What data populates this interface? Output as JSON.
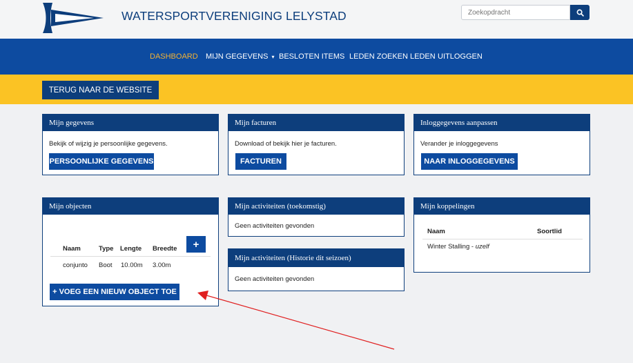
{
  "header": {
    "site_title": "WATERSPORTVERENIGING LELYSTAD",
    "search_placeholder": "Zoekopdracht"
  },
  "nav": {
    "items": [
      {
        "label": "DASHBOARD",
        "active": true
      },
      {
        "label": "MIJN GEGEVENS",
        "dropdown": true
      },
      {
        "label": "BESLOTEN ITEMS"
      },
      {
        "label": "LEDEN ZOEKEN LEDEN"
      },
      {
        "label": "UITLOGGEN"
      }
    ],
    "caret": "▾"
  },
  "back_button": "TERUG NAAR DE WEBSITE",
  "panels": {
    "gegevens": {
      "title": "Mijn gegevens",
      "text": "Bekijk of wijzig je persoonlijke gegevens.",
      "button": "PERSOONLIJKE GEGEVENS"
    },
    "facturen": {
      "title": "Mijn facturen",
      "text": "Download of bekijk hier je facturen.",
      "button": "FACTUREN"
    },
    "inlog": {
      "title": "Inloggegevens aanpassen",
      "text": "Verander je inloggegevens",
      "button": "NAAR INLOGGEGEVENS"
    },
    "objecten": {
      "title": "Mijn objecten",
      "columns": [
        "Naam",
        "Type",
        "Lengte",
        "Breedte"
      ],
      "rows": [
        [
          "conjunto",
          "Boot",
          "10.00m",
          "3.00m"
        ]
      ],
      "add_icon": "+",
      "add_button": "+ VOEG EEN NIEUW OBJECT TOE"
    },
    "activiteiten_toekomstig": {
      "title": "Mijn activiteiten (toekomstig)",
      "text": "Geen activiteiten gevonden"
    },
    "activiteiten_historie": {
      "title": "Mijn activiteiten (Historie dit seizoen)",
      "text": "Geen activiteiten gevonden"
    },
    "koppelingen": {
      "title": "Mijn koppelingen",
      "columns": [
        "Naam",
        "Soortlid"
      ],
      "row_name": "Winter Stalling -",
      "row_relation": "uzelf"
    }
  },
  "colors": {
    "brand": "#0d3e7c",
    "nav": "#0d4ba0",
    "accent_yellow": "#fbc324",
    "active_nav": "#f3b233",
    "annotation_arrow": "#e02020"
  }
}
